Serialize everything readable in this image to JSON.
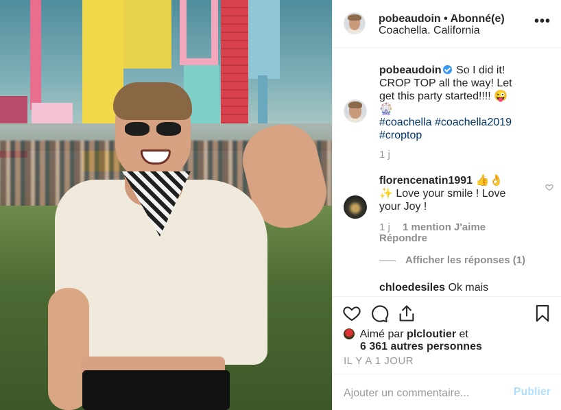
{
  "post": {
    "username": "pobeaudoin",
    "separator": "•",
    "follow_status": "Abonné(e)",
    "location": "Coachella. California",
    "more_icon": "more-options-icon"
  },
  "caption": {
    "username": "pobeaudoin",
    "text_line1": "So I did it!",
    "text_line2": "CROP TOP all the way! Let",
    "text_line3": "get this party started!!!! 😜",
    "text_line4": "🎡",
    "hashtags_line1": "#coachella #coachella2019",
    "hashtags_line2": "#croptop",
    "age": "1 j"
  },
  "comments": [
    {
      "username": "florencenatin1991",
      "text_line1": "👍👌",
      "text_line2": "✨ Love your smile ! Love",
      "text_line3": "your Joy !",
      "age": "1 j",
      "likes": "1 mention J'aime",
      "reply": "Répondre"
    }
  ],
  "view_replies": "Afficher les réponses (1)",
  "next_comment": {
    "username": "chloedesiles",
    "text": "Ok mais"
  },
  "likes": {
    "prefix": "Aimé par",
    "liker": "plcloutier",
    "connector": "et",
    "others": "6 361 autres personnes"
  },
  "timestamp": "IL Y A 1 JOUR",
  "add_comment": {
    "placeholder": "Ajouter un commentaire...",
    "publish_label": "Publier"
  },
  "colors": {
    "accent": "#3897f0",
    "publish_disabled": "#b2dffc",
    "hashtag": "#003569",
    "muted": "#999999"
  },
  "icons": [
    "heart-icon",
    "comment-icon",
    "share-icon",
    "bookmark-icon",
    "verified-badge-icon",
    "like-heart-icon"
  ]
}
